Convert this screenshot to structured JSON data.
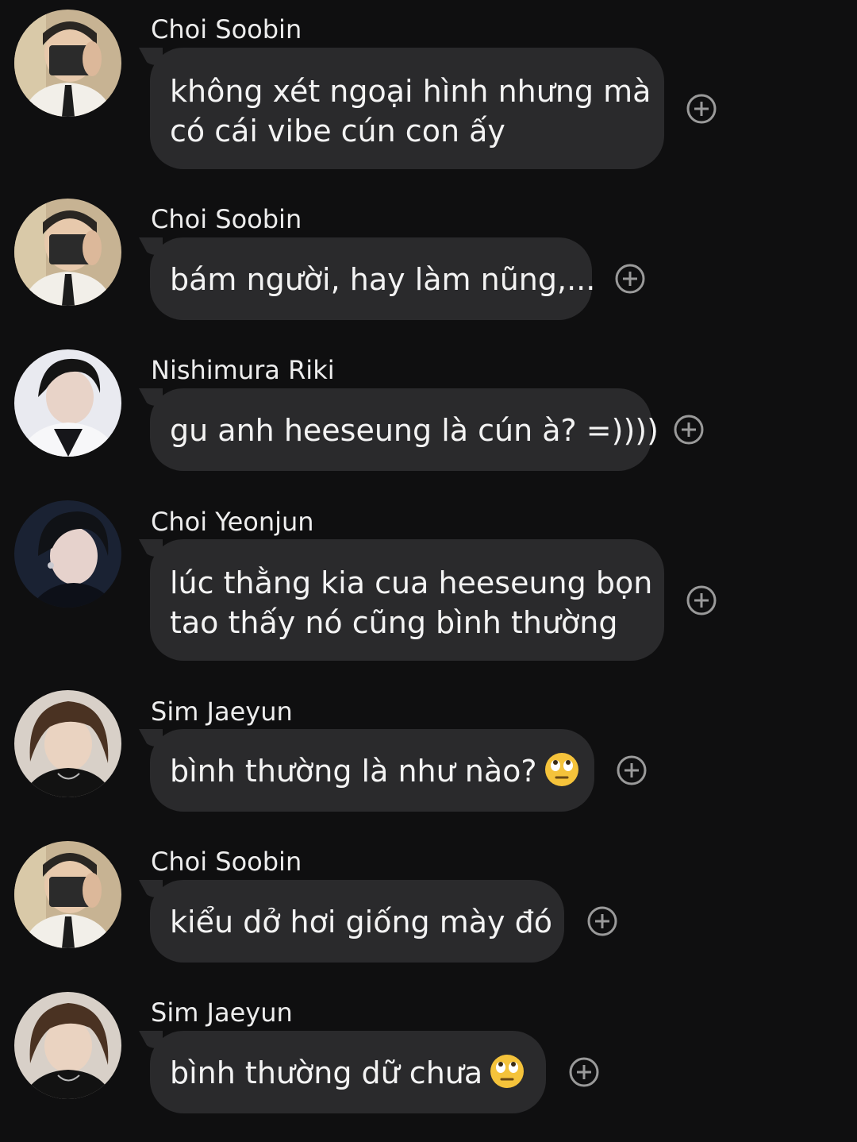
{
  "conversation": {
    "messages": [
      {
        "sender": "Choi Soobin",
        "lines": [
          "không xét ngoại hình nhưng mà",
          "có cái vibe cún con ấy"
        ]
      },
      {
        "sender": "Choi Soobin",
        "lines": [
          "bám người, hay làm nũng,..."
        ]
      },
      {
        "sender": "Nishimura Riki",
        "lines": [
          "gu anh heeseung là cún à? =))))"
        ]
      },
      {
        "sender": "Choi Yeonjun",
        "lines": [
          "lúc thằng kia cua heeseung bọn",
          "tao thấy nó cũng bình thường"
        ]
      },
      {
        "sender": "Sim Jaeyun",
        "lines": [
          "bình thường là như nào?"
        ],
        "emoji": "face-with-rolling-eyes"
      },
      {
        "sender": "Choi Soobin",
        "lines": [
          "kiểu dở hơi giống mày đó"
        ]
      },
      {
        "sender": "Sim Jaeyun",
        "lines": [
          "bình thường dữ chưa"
        ],
        "emoji": "face-with-rolling-eyes"
      }
    ]
  },
  "icons": {
    "reaction": "add-reaction-icon"
  },
  "colors": {
    "background": "#0f0f10",
    "bubble": "#2a2a2c",
    "text": "#f3f3f3",
    "icon": "#9a9a9a"
  }
}
